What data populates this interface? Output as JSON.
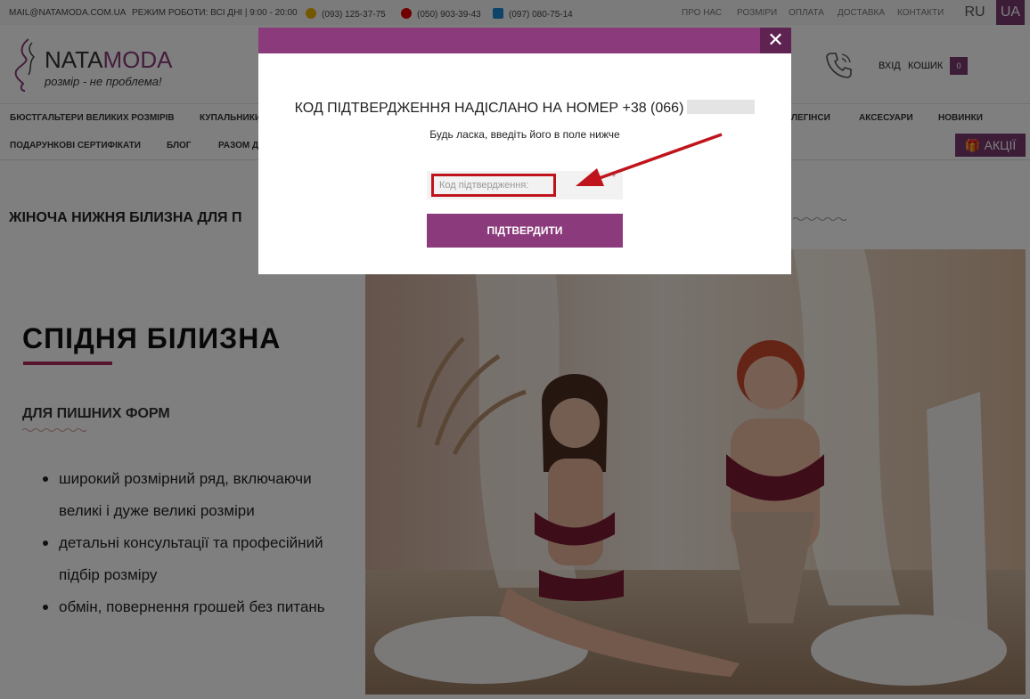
{
  "topbar": {
    "email": "MAIL@NATAMODA.COM.UA",
    "schedule": "РЕЖИМ РОБОТИ: ВСІ ДНІ | 9:00 - 20:00",
    "phones": [
      "(093) 125-37-75",
      "(050) 903-39-43",
      "(097) 080-75-14"
    ],
    "nav": [
      "ПРО НАС",
      "РОЗМІРИ",
      "ОПЛАТА",
      "ДОСТАВКА",
      "КОНТАКТИ"
    ],
    "languages": [
      "RU",
      "UA"
    ]
  },
  "header": {
    "logo_brand_a": "NATA",
    "logo_brand_b": "MODA",
    "logo_slogan": "розмір - не проблема!",
    "login": "ВХІД",
    "cart": "КОШИК",
    "cart_count": "0"
  },
  "menu": {
    "row1": [
      "БЮСТГАЛЬТЕРИ ВЕЛИКИХ РОЗМІРІВ",
      "КУПАЛЬНИКИ",
      "ЛЕГІНСИ",
      "АКСЕСУАРИ",
      "НОВИНКИ"
    ],
    "row2": [
      "ПОДАРУНКОВІ СЕРТИФІКАТИ",
      "БЛОГ",
      "РАЗОМ Д"
    ],
    "promo": "АКЦІЇ"
  },
  "main": {
    "heading": "ЖІНОЧА НИЖНЯ БІЛИЗНА ДЛЯ П",
    "hero_title": "СПІДНЯ БІЛИЗНА",
    "hero_sub": "ДЛЯ ПИШНИХ ФОРМ",
    "bullets": [
      "широкий розмірний ряд, включаючи великі і дуже великі розміри",
      "детальні консультації та професійний підбір розміру",
      "обмін, повернення грошей без питань"
    ]
  },
  "modal": {
    "title": "КОД ПІДТВЕРДЖЕННЯ НАДІСЛАНО НА НОМЕР +38 (066)",
    "subtitle": "Будь ласка, введіть його в поле нижче",
    "code_placeholder": "Код підтвердження:",
    "required_mark": "*",
    "confirm_label": "ПІДТВЕРДИТИ",
    "close_glyph": "✕"
  },
  "colors": {
    "brand": "#8b3a7b",
    "highlight": "#c0141c"
  }
}
